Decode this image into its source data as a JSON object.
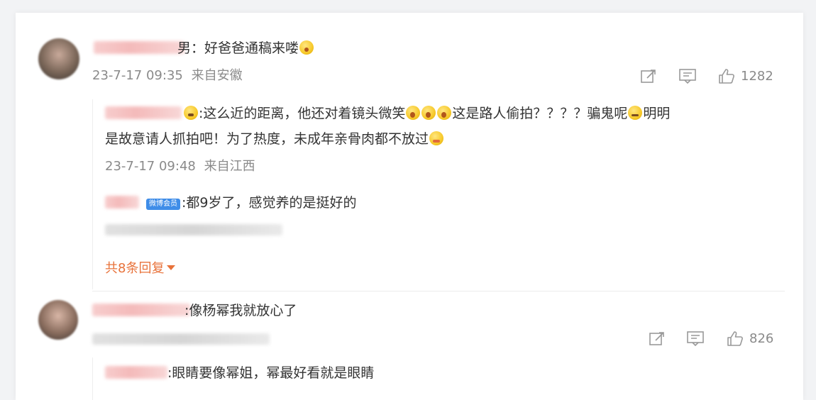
{
  "comments": [
    {
      "text_suffix": "男：好爸爸通稿来喽",
      "emoji": "smile-emoji",
      "time": "23-7-17 09:35",
      "location": "来自安徽",
      "likes": "1282",
      "replies": [
        {
          "line1_a": ":这么近的距离，他还对着镜头微笑",
          "line1_b": "这是路人偷拍？？？？骗鬼呢",
          "line1_c": "明明",
          "line2": "是故意请人抓拍吧！为了热度，未成年亲骨肉都不放过",
          "time": "23-7-17 09:48",
          "location": "来自江西"
        },
        {
          "badge": "微博会员",
          "text": ":都9岁了，感觉养的是挺好的"
        }
      ],
      "expand_label": "共8条回复"
    },
    {
      "text": ":像杨幂我就放心了",
      "likes": "826",
      "replies": [
        {
          "text": ":眼睛要像幂姐，幂最好看就是眼睛"
        }
      ]
    }
  ],
  "colors": {
    "accent": "#e8723a",
    "meta_gray": "#8a8a8a",
    "text": "#333333",
    "vip_blue": "#3f8de8"
  }
}
